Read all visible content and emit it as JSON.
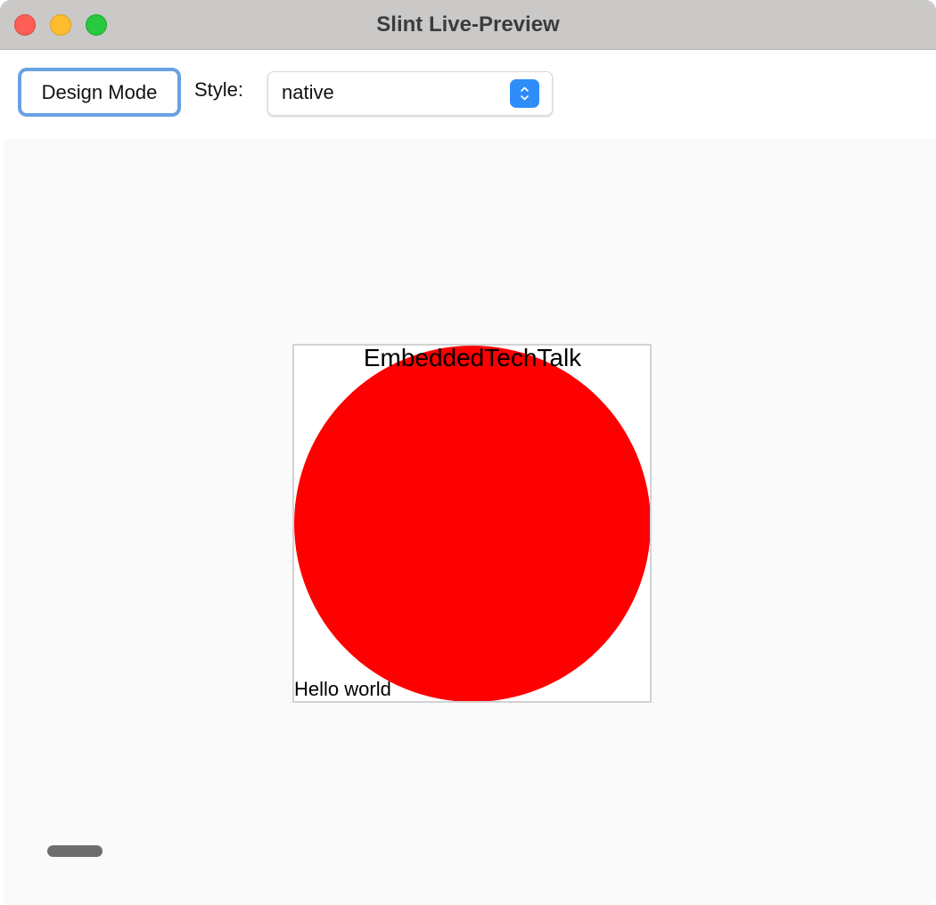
{
  "window": {
    "title": "Slint Live-Preview"
  },
  "toolbar": {
    "design_mode_label": "Design Mode",
    "style_label": "Style:",
    "style_select_value": "native"
  },
  "preview": {
    "title_text": "EmbeddedTechTalk",
    "hello_text": "Hello world",
    "circle_color": "#ff0000"
  },
  "colors": {
    "accent": "#2e8df9",
    "focus_ring": "#6aa1e2",
    "close": "#fe5f57",
    "minimize": "#febc2e",
    "zoom": "#28c840"
  },
  "icons": {
    "select": "chevron-updown-icon"
  }
}
